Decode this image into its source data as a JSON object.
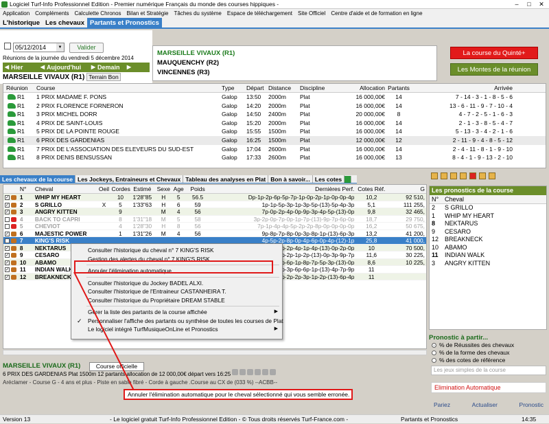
{
  "window": {
    "title": "Logiciel Turf-Info Professionnel Edition - Premier numérique Français du monde des courses hippiques -"
  },
  "menu": [
    "Application",
    "Compléments",
    "Calculette Chronos",
    "Bilan et Stratégie",
    "Tâches du système",
    "Espace de téléchargement",
    "Site Officiel",
    "Centre d'aide et de formation en ligne"
  ],
  "tabs": [
    "L'historique",
    "Les chevaux",
    "Partants et Pronostics"
  ],
  "date": {
    "value": "05/12/2014",
    "valider": "Valider",
    "reunions": "Réunions de la journée du vendredi 5 décembre 2014"
  },
  "nav": {
    "hier": "Hier",
    "aujourdhui": "Aujourd'hui",
    "demain": "Demain"
  },
  "course_header": {
    "name": "MARSEILLE VIVAUX (R1)",
    "terrain": "Terrain Bon"
  },
  "meetings": [
    "MARSEILLE VIVAUX (R1)",
    "MAUQUENCHY (R2)",
    "VINCENNES (R3)"
  ],
  "buttons": {
    "quinte": "La course du Quinté+",
    "montes": "Les Montes de la réunion"
  },
  "race_cols": [
    "Réunion",
    "Course",
    "Type",
    "Départ",
    "Distance",
    "Discipline",
    "Allocation",
    "Partants",
    "Arrivée"
  ],
  "races": [
    {
      "reu": "R1",
      "course": "1 PRIX MADAME F. PONS",
      "type": "Galop",
      "dep": "13:50",
      "dist": "2000m",
      "disc": "Plat",
      "all": "16 000,00€",
      "part": "14",
      "arr": "7 - 14 - 3 - 1 - 8 - 5 - 6"
    },
    {
      "reu": "R1",
      "course": "2 PRIX FLORENCE FORNERON",
      "type": "Galop",
      "dep": "14:20",
      "dist": "2000m",
      "disc": "Plat",
      "all": "16 000,00€",
      "part": "14",
      "arr": "13 - 6 - 11 - 9 - 7 - 10 - 4"
    },
    {
      "reu": "R1",
      "course": "3 PRIX MICHEL DORR",
      "type": "Galop",
      "dep": "14:50",
      "dist": "2400m",
      "disc": "Plat",
      "all": "20 000,00€",
      "part": "8",
      "arr": "4 - 7 - 2 - 5 - 1 - 6 - 3"
    },
    {
      "reu": "R1",
      "course": "4 PRIX DE SAINT-LOUIS",
      "type": "Galop",
      "dep": "15:20",
      "dist": "2000m",
      "disc": "Plat",
      "all": "16 000,00€",
      "part": "14",
      "arr": "2 - 1 - 3 - 8 - 5 - 4 - 7"
    },
    {
      "reu": "R1",
      "course": "5 PRIX DE LA POINTE ROUGE",
      "type": "Galop",
      "dep": "15:55",
      "dist": "1500m",
      "disc": "Plat",
      "all": "16 000,00€",
      "part": "14",
      "arr": "5 - 13 - 3 - 4 - 2 - 1 - 6"
    },
    {
      "reu": "R1",
      "course": "6 PRIX DES GARDENIAS",
      "type": "Galop",
      "dep": "16:25",
      "dist": "1500m",
      "disc": "Plat",
      "all": "12 000,00€",
      "part": "12",
      "arr": "2 - 11 - 9 - 4 - 8 - 5 - 12"
    },
    {
      "reu": "R1",
      "course": "7 PRIX DE L'ASSOCIATION DES ELEVEURS DU SUD-EST",
      "type": "Galop",
      "dep": "17:04",
      "dist": "2600m",
      "disc": "Plat",
      "all": "16 000,00€",
      "part": "14",
      "arr": "2 - 4 - 11 - 8 - 1 - 9 - 10"
    },
    {
      "reu": "R1",
      "course": "8 PRIX DENIS BENSUSSAN",
      "type": "Galop",
      "dep": "17:33",
      "dist": "2600m",
      "disc": "Plat",
      "all": "16 000,00€",
      "part": "13",
      "arr": "8 - 4 - 1 - 9 - 13 - 2 - 10"
    }
  ],
  "content_tabs": [
    "Les chevaux de la course",
    "Les Jockeys, Entraineurs et Chevaux",
    "Tableau des analyses en Plat",
    "Bon à savoir...",
    "Les cotes"
  ],
  "horse_cols": [
    "N°",
    "Cheval",
    "Oeil",
    "Cordes",
    "Estimé",
    "Sexe",
    "Age",
    "Poids",
    "Dernières Perf.",
    "Cotes Réf.",
    "G"
  ],
  "horses": [
    {
      "n": "1",
      "name": "WHIP MY HEART",
      "oeil": "",
      "cord": "10",
      "est": "1'28\"85",
      "sex": "H",
      "age": "5",
      "poids": "56.5",
      "perf": "Dp-1p-2p-6p-5p-7p-1p-0p-2p-1p-0p-0p-4p",
      "cote": "10,2",
      "g": "92 510,",
      "cls": "alt"
    },
    {
      "n": "2",
      "name": "S GRILLO",
      "oeil": "X",
      "cord": "5",
      "est": "1'33\"63",
      "sex": "H",
      "age": "6",
      "poids": "59",
      "perf": "1p-1p-5p-3p-1p-3p-5p-(13)-5p-4p-3p",
      "cote": "5,1",
      "g": "111 255,",
      "cls": ""
    },
    {
      "n": "3",
      "name": "ANGRY KITTEN",
      "oeil": "",
      "cord": "9",
      "est": "",
      "sex": "M",
      "age": "4",
      "poids": "56",
      "perf": "7p-0p-2p-4p-0p-9p-3p-4p-5p-(13)-0p",
      "cote": "9,8",
      "g": "32 465,",
      "cls": "alt"
    },
    {
      "n": "4",
      "name": "BACK TO CAPRI",
      "oeil": "",
      "cord": "8",
      "est": "1'31\"18",
      "sex": "M",
      "age": "5",
      "poids": "58",
      "perf": "3p-2p-0p-7p-0p-1p-7p-(13)-9p-7p-6p-0p",
      "cote": "18,7",
      "g": "29 750,",
      "cls": "grey"
    },
    {
      "n": "5",
      "name": "CHEVIOT",
      "oeil": "",
      "cord": "4",
      "est": "1'28\"30",
      "sex": "H",
      "age": "8",
      "poids": "56",
      "perf": "7p-1p-4p-4p-5p-2p-2p-8p-0p-0p-0p-0p",
      "cote": "16,2",
      "g": "50 675,",
      "cls": "grey"
    },
    {
      "n": "6",
      "name": "MAJESTIC POWER",
      "oeil": "",
      "cord": "1",
      "est": "1'31\"26",
      "sex": "M",
      "age": "4",
      "poids": "56",
      "perf": "9p-8p-7p-8p-0p-3p-8p-1p-(13)-6p-3p",
      "cote": "13,2",
      "g": "41 200,",
      "cls": ""
    },
    {
      "n": "7",
      "name": "KING'S RISK",
      "oeil": "",
      "cord": "",
      "est": "",
      "sex": "",
      "age": "",
      "poids": "",
      "perf": "4p-5p-2p-8p-0p-4p-6p-0p-4p-(12)-1p",
      "cote": "25,8",
      "g": "41 000,",
      "cls": "sel"
    },
    {
      "n": "8",
      "name": "NEKTARUS",
      "oeil": "",
      "cord": "",
      "est": "",
      "sex": "",
      "age": "",
      "poids": "",
      "perf": "4p-1p-0p-2p-4p-1p-4p-(13)-0p-2p-0p",
      "cote": "10",
      "g": "70 500,",
      "cls": "alt"
    },
    {
      "n": "9",
      "name": "CESARO",
      "oeil": "",
      "cord": "",
      "est": "",
      "sex": "",
      "age": "",
      "poids": "",
      "perf": "3p-2p-2p-1p-2p-(13)-0p-3p-9p-7p",
      "cote": "11,6",
      "g": "30 225,",
      "cls": ""
    },
    {
      "n": "10",
      "name": "ABAMO",
      "oeil": "",
      "cord": "",
      "est": "",
      "sex": "",
      "age": "",
      "poids": "",
      "perf": "0p-5p-6p-1p-8p-7p-5p-3p-(13)-0p",
      "cote": "8,6",
      "g": "10 225,",
      "cls": "alt"
    },
    {
      "n": "11",
      "name": "INDIAN WALK",
      "oeil": "",
      "cord": "",
      "est": "",
      "sex": "",
      "age": "",
      "poids": "",
      "perf": "6p-5p-5p-3p-6p-6p-1p-(13)-4p-7p-9p",
      "cote": "11",
      "g": "",
      "cls": ""
    },
    {
      "n": "12",
      "name": "BREAKNECK",
      "oeil": "",
      "cord": "",
      "est": "",
      "sex": "",
      "age": "",
      "poids": "",
      "perf": "1p-3p-1p-2p-2p-3p-1p-2p-(13)-6p-4p",
      "cote": "11",
      "g": "",
      "cls": "alt"
    }
  ],
  "context_menu": [
    "Consulter l'historique du cheval n° 7 KING'S RISK",
    "Gestion des alertes du cheval n° 7 KING'S RISK",
    "Annuler l'élimination automatique",
    "Consulter l'historique du Jockey BADEL ALXI.",
    "Consulter l'historique de l'Entraineur CASTANHEIRA T.",
    "Consulter l'historique du Propriétaire DREAM STABLE",
    "Gérer la liste des partants de la course affichée",
    "Personnaliser l'affiche des partants ou synthèse de toutes les courses de Plat",
    "Le logiciel intégré TurfMusiqueOnLine et Pronostics"
  ],
  "pronos": {
    "title": "Les pronostics de la course",
    "cols": [
      "N°",
      "Cheval"
    ],
    "rows": [
      {
        "n": "2",
        "name": "S GRILLO"
      },
      {
        "n": "1",
        "name": "WHIP MY HEART"
      },
      {
        "n": "8",
        "name": "NEKTARUS"
      },
      {
        "n": "9",
        "name": "CESARO"
      },
      {
        "n": "12",
        "name": "BREAKNECK"
      },
      {
        "n": "10",
        "name": "ABAMO"
      },
      {
        "n": "11",
        "name": "INDIAN WALK"
      },
      {
        "n": "3",
        "name": "ANGRY KITTEN"
      }
    ]
  },
  "pronostic_area": {
    "title": "Pronostic à partir...",
    "options": [
      "% de Réussites des chevaux",
      "% de la forme des chevaux",
      "% des cotes de référence"
    ],
    "jeux": "Les jeux simples de la course",
    "elim": "Elimination Automatique",
    "btn_pariez": "Pariez",
    "btn_actualiser": "Actualiser",
    "btn_pronostic": "Pronostic"
  },
  "bottom": {
    "title": "MARSEILLE VIVAUX (R1)",
    "course_officielle": "Course officielle",
    "line": "6 PRIX DES GARDENIAS Plat 1500m 12 partants allocation de 12 000,00€ départ vers 16:25",
    "areclamer": "Aréclamer - Course G - 4 ans et plus - Piste en sable fibré - Corde à gauche .Course au CX de (033 %) --ACBB--",
    "tooltip": "Annuler l'élimination automatique pour le cheval sélectionné qui vous semble erronée."
  },
  "status": {
    "version": "Version 13",
    "center": "- Le logiciel gratuit Turf-Info Professionnel Edition - © Tous droits réservés Turf-France.com -",
    "mode": "Partants et Pronostics",
    "time": "14:35"
  }
}
